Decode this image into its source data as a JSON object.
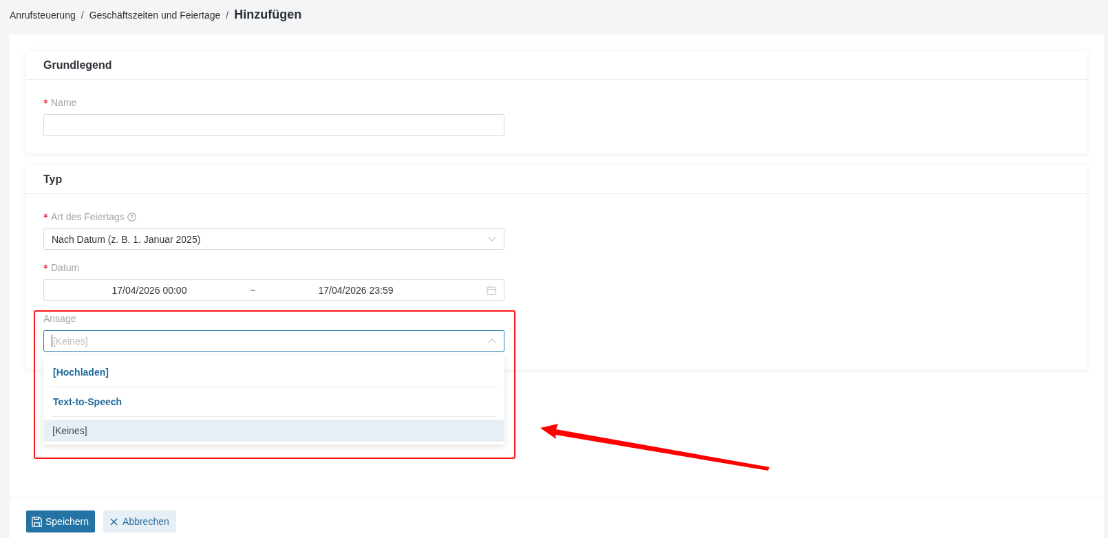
{
  "breadcrumb": [
    {
      "label": "Anrufsteuerung",
      "separator": "/",
      "current": false
    },
    {
      "label": "Geschäftszeiten und Feiertage",
      "separator": "/",
      "current": false
    },
    {
      "label": "Hinzufügen",
      "current": true
    }
  ],
  "sections": [
    {
      "title": "Grundlegend",
      "fields": [
        {
          "kind": "text",
          "label": "Name",
          "required": true
        }
      ]
    },
    {
      "title": "Typ",
      "fields": [
        {
          "kind": "select",
          "label": "Art des Feiertags",
          "required": true,
          "help": true,
          "value": "Nach Datum (z. B. 1. Januar 2025)",
          "expanded": false,
          "focused": false
        },
        {
          "kind": "daterange",
          "label": "Datum",
          "required": true,
          "start": "17/04/2026 00:00",
          "separator": "~",
          "end": "17/04/2026 23:59"
        },
        {
          "kind": "select",
          "label": "Ansage",
          "required": false,
          "placeholder": "[Keines]",
          "expanded": true,
          "focused": true,
          "options": [
            {
              "kind": "action",
              "label": "[Hochladen]",
              "selected": false
            },
            {
              "kind": "action",
              "label": "Text-to-Speech",
              "selected": false
            },
            {
              "kind": "option",
              "label": "[Keines]",
              "selected": true
            }
          ],
          "annotation": {
            "frame": true,
            "arrow": true
          }
        }
      ]
    }
  ],
  "buttons": [
    {
      "kind": "primary",
      "label": "Speichern"
    },
    {
      "kind": "secondary",
      "label": "Abbrechen"
    }
  ]
}
